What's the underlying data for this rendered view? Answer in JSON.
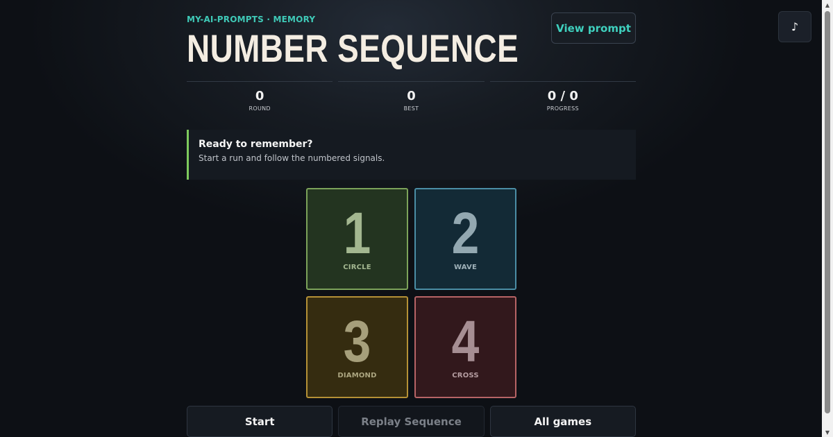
{
  "header": {
    "eyebrow": "MY-AI-PROMPTS · MEMORY",
    "title": "NUMBER SEQUENCE",
    "view_prompt_label": "View prompt",
    "music_toggle_glyph": "♪"
  },
  "stats": [
    {
      "value": "0",
      "label": "ROUND"
    },
    {
      "value": "0",
      "label": "BEST"
    },
    {
      "value": "0 / 0",
      "label": "PROGRESS"
    }
  ],
  "message": {
    "title": "Ready to remember?",
    "text": "Start a run and follow the numbered signals.",
    "accent_color": "#7ecb5d"
  },
  "pads": [
    {
      "number": "1",
      "label": "CIRCLE",
      "color": "#7ca35a"
    },
    {
      "number": "2",
      "label": "WAVE",
      "color": "#4b8ea6"
    },
    {
      "number": "3",
      "label": "DIAMOND",
      "color": "#b59136"
    },
    {
      "number": "4",
      "label": "CROSS",
      "color": "#b76466"
    }
  ],
  "actions": {
    "start_label": "Start",
    "replay_label": "Replay Sequence",
    "all_games_label": "All games"
  },
  "colors": {
    "accent": "#3fc9b7",
    "background": "#0b0d11"
  }
}
